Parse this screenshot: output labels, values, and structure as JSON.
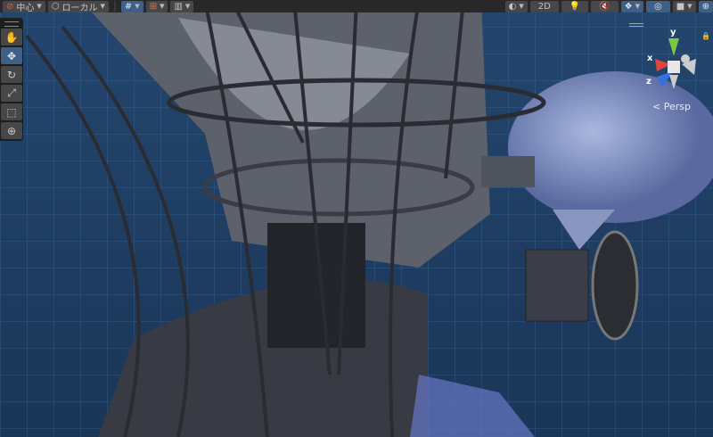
{
  "toolbar": {
    "pivot_label": "中心",
    "space_label": "ローカル",
    "mode_2d_label": "2D"
  },
  "tools": [
    "hand-tool",
    "move-tool",
    "rotate-tool",
    "scale-tool",
    "rect-tool",
    "transform-tool"
  ],
  "gizmo": {
    "x": "x",
    "y": "y",
    "z": "z",
    "projection": "Persp"
  },
  "colors": {
    "toolbar": "#282828",
    "button": "#474747",
    "active": "#3f5f86",
    "scene": "#1d3a5c"
  }
}
